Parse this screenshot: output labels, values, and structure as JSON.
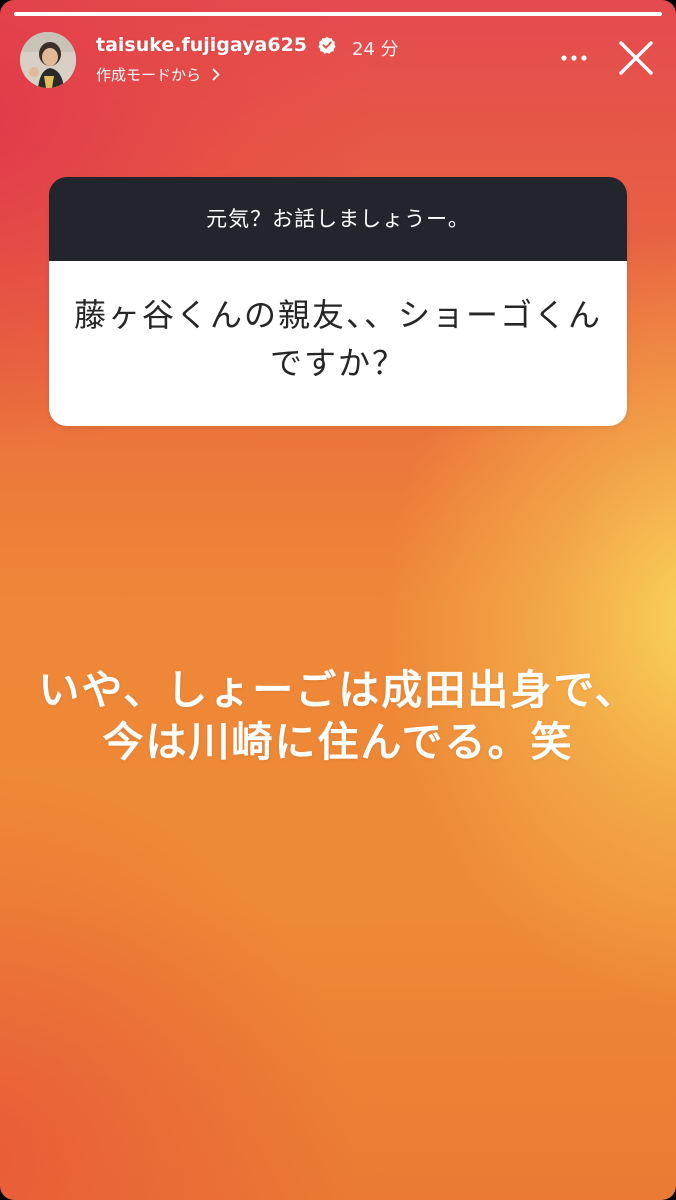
{
  "story": {
    "progress": 1.0
  },
  "header": {
    "username": "taisuke.fujigaya625",
    "time": "24 分",
    "sub_label": "作成モードから",
    "avatar_icon": "avatar-photo",
    "verified_icon": "verified-badge-icon",
    "more_icon": "more-dots-icon",
    "close_icon": "close-icon"
  },
  "question": {
    "prompt": "元気？お話しましょうー。",
    "line1": "藤ヶ谷くんの親友、、ショーゴくん",
    "line2": "ですか？"
  },
  "answer": {
    "line1": "いや、しょーごは成田出身で、",
    "line2": "今は川崎に住んでる。笑"
  }
}
